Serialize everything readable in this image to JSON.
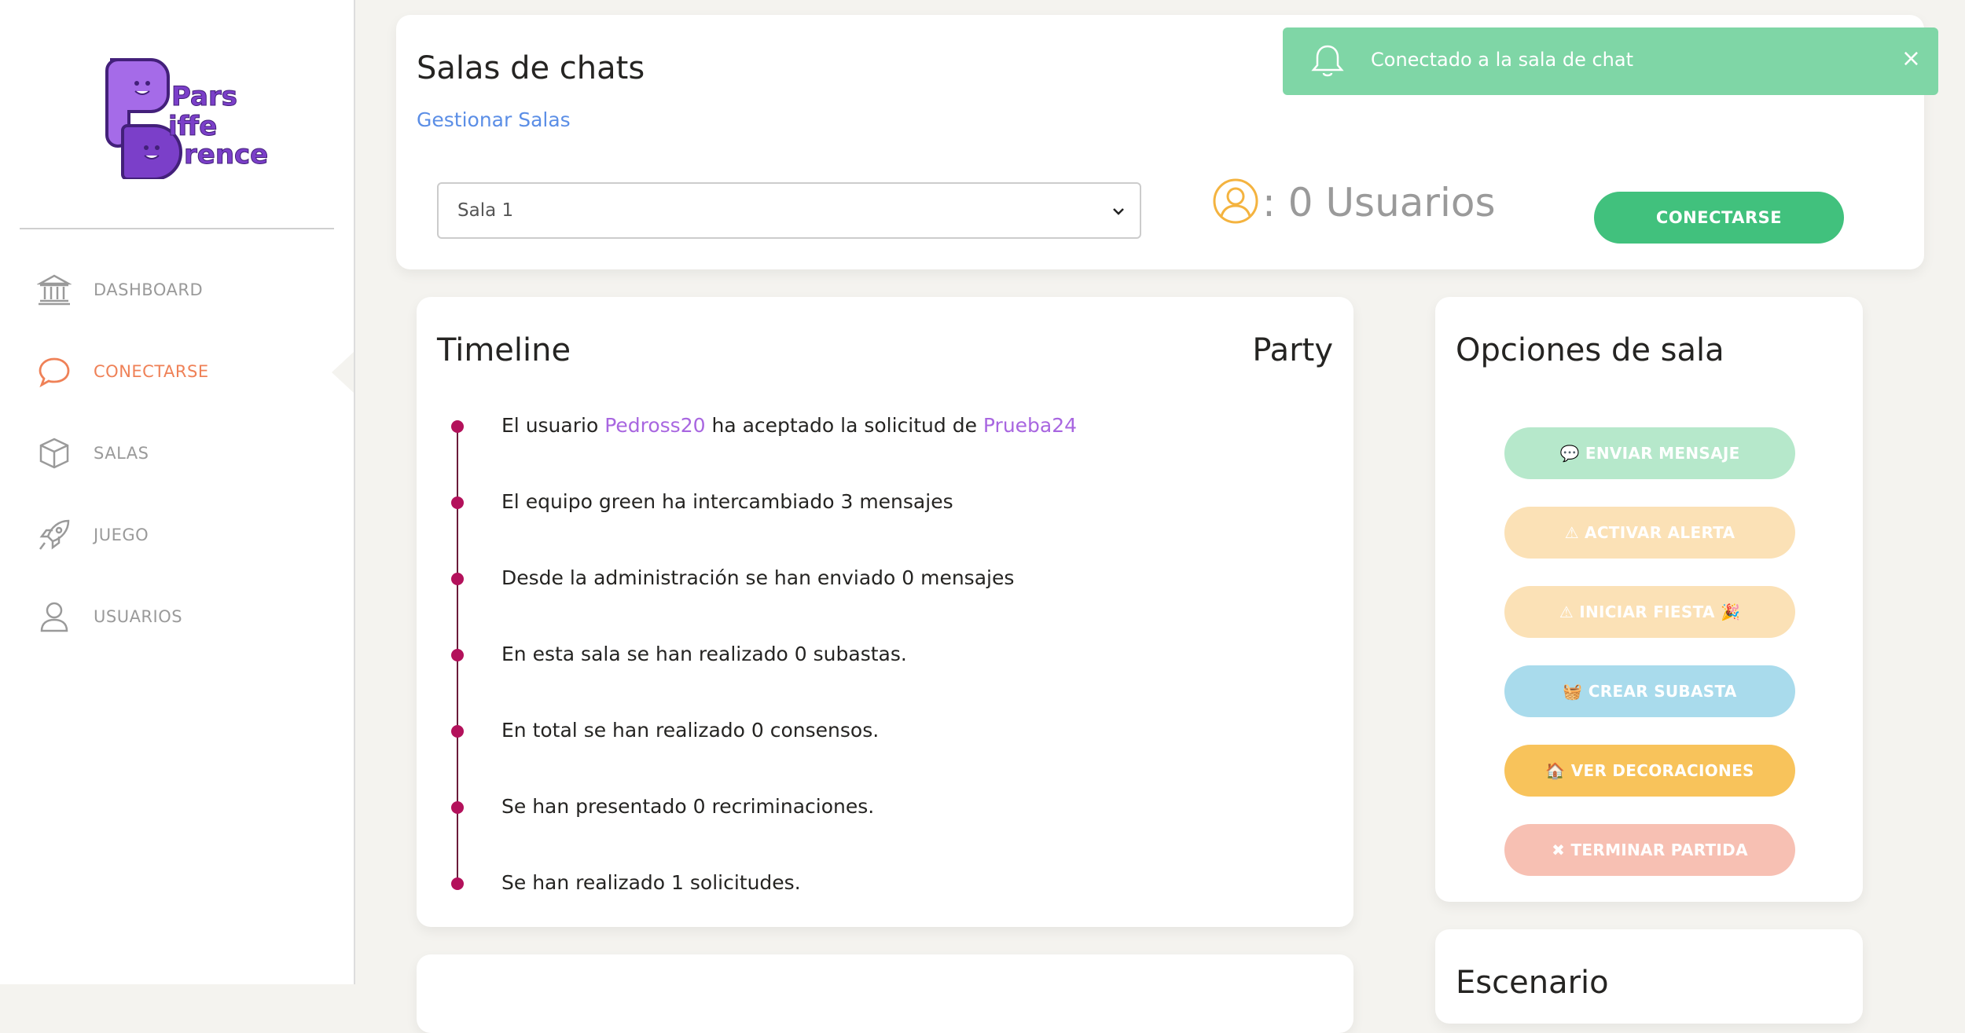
{
  "brand": {
    "logo_lines": [
      "Pars",
      "iffe",
      "rence"
    ],
    "logo_initials": [
      "P",
      "D",
      "D"
    ]
  },
  "sidebar": {
    "items": [
      {
        "label": "DASHBOARD",
        "icon": "bank-icon"
      },
      {
        "label": "CONECTARSE",
        "icon": "chat-icon",
        "active": true
      },
      {
        "label": "SALAS",
        "icon": "box-icon"
      },
      {
        "label": "JUEGO",
        "icon": "rocket-icon"
      },
      {
        "label": "USUARIOS",
        "icon": "user-icon"
      }
    ]
  },
  "header": {
    "title": "Salas de chats",
    "manage_link": "Gestionar Salas",
    "room_select": {
      "value": "Sala 1"
    },
    "users_label": ": 0 Usuarios",
    "connect_button": "CONECTARSE"
  },
  "toast": {
    "message": "Conectado a la sala de chat",
    "close": "×"
  },
  "timeline": {
    "title": "Timeline",
    "right_label": "Party",
    "items": [
      {
        "pre": "El usuario ",
        "user1": "Pedross20",
        "mid": " ha aceptado la solicitud de ",
        "user2": "Prueba24"
      },
      {
        "text": "El equipo green ha intercambiado 3 mensajes"
      },
      {
        "text": "Desde la administración se han enviado 0 mensajes"
      },
      {
        "text": "En esta sala se han realizado 0 subastas."
      },
      {
        "text": "En total se han realizado 0 consensos."
      },
      {
        "text": "Se han presentado 0 recriminaciones."
      },
      {
        "text": "Se han realizado 1 solicitudes."
      }
    ]
  },
  "options": {
    "title": "Opciones de sala",
    "buttons": [
      {
        "label": "💬 ENVIAR MENSAJE",
        "color": "#b6e8cb"
      },
      {
        "label": "⚠ ACTIVAR ALERTA",
        "color": "#fbe1b6"
      },
      {
        "label": "⚠ INICIAR FIESTA 🎉",
        "color": "#fbe1b6"
      },
      {
        "label": "🧺 CREAR SUBASTA",
        "color": "#a9dbec"
      },
      {
        "label": "🏠 VER DECORACIONES",
        "color": "#f8c35b"
      },
      {
        "label": "✖ TERMINAR PARTIDA",
        "color": "#f7c0b3"
      }
    ]
  },
  "stage": {
    "title": "Escenario"
  },
  "colors": {
    "accent": "#ef8157",
    "success": "#41c17d",
    "link": "#5b8ee6",
    "user": "#a866e0",
    "timeline_dot": "#b3115b"
  }
}
